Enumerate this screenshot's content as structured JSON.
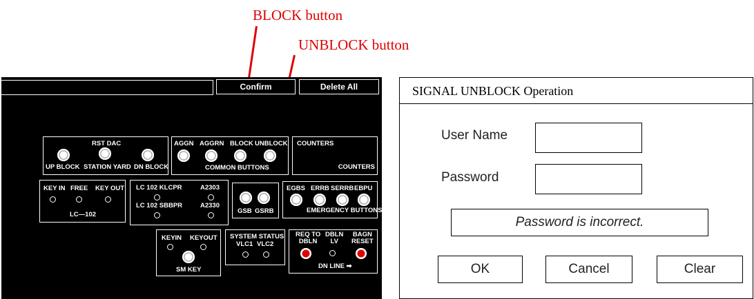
{
  "annotations": {
    "block_label": "BLOCK button",
    "unblock_label": "UNBLOCK button",
    "color": "#e00000"
  },
  "panel": {
    "toolbar": {
      "confirm_label": "Confirm",
      "delete_all_label": "Delete All"
    },
    "rst_group": {
      "title": "RST DAC",
      "buttons": [
        "UP BLOCK",
        "STATION YARD",
        "DN BLOCK"
      ]
    },
    "common_group": {
      "buttons": [
        "AGGN",
        "AGGRN",
        "BLOCK",
        "UNBLOCK"
      ],
      "caption": "COMMON BUTTONS"
    },
    "counters_group": {
      "title": "COUNTERS",
      "caption": "COUNTERS"
    },
    "lc102_group": {
      "labels": [
        "KEY IN",
        "FREE",
        "KEY OUT"
      ],
      "caption": "LC—102"
    },
    "lc102_detail_group": {
      "row1_left": "LC 102 KLCPR",
      "row1_right": "A2303",
      "row2_left": "LC 102 SBBPR",
      "row2_right": "A2330"
    },
    "gsb_group": {
      "labels": [
        "GSB",
        "GSRB"
      ]
    },
    "emergency_group": {
      "labels": [
        "EGBS",
        "ERRB",
        "SERRB",
        "EBPU"
      ],
      "caption": "EMERGENCY BUTTONS"
    },
    "smkey_group": {
      "labels": [
        "KEYIN",
        "KEYOUT"
      ],
      "caption": "SM KEY"
    },
    "system_group": {
      "title": "SYSTEM STATUS",
      "labels": [
        "VLC1",
        "VLC2"
      ]
    },
    "dnline_group": {
      "labels": [
        "REQ TO\nDBLN",
        "DBLN\nLV",
        "BAGN\nRESET"
      ],
      "caption": "DN LINE",
      "arrow": "➡"
    }
  },
  "dialog": {
    "title": "SIGNAL UNBLOCK Operation",
    "username_label": "User Name",
    "username_value": "",
    "password_label": "Password",
    "password_value": "",
    "message": "Password is incorrect.",
    "ok_label": "OK",
    "cancel_label": "Cancel",
    "clear_label": "Clear"
  }
}
